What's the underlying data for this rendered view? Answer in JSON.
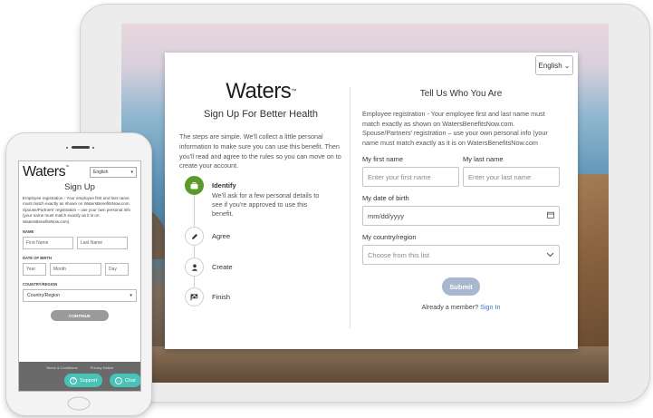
{
  "tablet": {
    "language_selector": "English",
    "logo": "Waters",
    "logo_mark": "™",
    "signup_title": "Sign Up For Better Health",
    "intro": "The steps are simple. We'll collect a little personal information to make sure you can use this benefit. Then you'll read and agree to the rules so you can move on to create your account.",
    "steps": [
      {
        "label": "Identify",
        "desc": "We'll ask for a few personal details to see if you're approved to use this benefit.",
        "icon": "briefcase-icon",
        "active": true
      },
      {
        "label": "Agree",
        "desc": "",
        "icon": "pencil-icon",
        "active": false
      },
      {
        "label": "Create",
        "desc": "",
        "icon": "user-icon",
        "active": false
      },
      {
        "label": "Finish",
        "desc": "",
        "icon": "finish-flag-icon",
        "active": false
      }
    ],
    "form": {
      "title": "Tell Us Who You Are",
      "desc": "Employee registration - Your employee first and last name must match exactly as shown on WatersBenefitsNow.com. Spouse/Partners' registration – use your own personal info (your name must match exactly as it is on WatersBenefitsNow.com",
      "first_name_label": "My first name",
      "first_name_placeholder": "Enter your first name",
      "last_name_label": "My last name",
      "last_name_placeholder": "Enter your last name",
      "dob_label": "My date of birth",
      "dob_placeholder": "mm/dd/yyyy",
      "country_label": "My country/region",
      "country_placeholder": "Choose from this list",
      "submit_label": "Submit",
      "member_text": "Already a member?",
      "signin_link": "Sign In"
    }
  },
  "phone": {
    "logo": "Waters",
    "logo_mark": "™",
    "language_selector": "English",
    "title": "Sign Up",
    "desc": "Employee registration - Your employee first and last name must match exactly as shown on WatersBenefitsNow.com. Spouse/Partners' registration – use your own personal info (your name must match exactly as it is on WatersBenefitsNow.com)",
    "name_label": "NAME",
    "first_name_placeholder": "First Name",
    "last_name_placeholder": "Last Name",
    "dob_label": "DATE OF BIRTH",
    "year_placeholder": "Year",
    "month_placeholder": "Month",
    "day_placeholder": "Day",
    "country_label": "COUNTRY/REGION",
    "country_value": "Country/Region",
    "continue_label": "CONTINUE",
    "terms_link": "Terms & Conditions",
    "privacy_link": "Privacy Notice",
    "support_label": "Support",
    "chat_label": "Chat"
  }
}
